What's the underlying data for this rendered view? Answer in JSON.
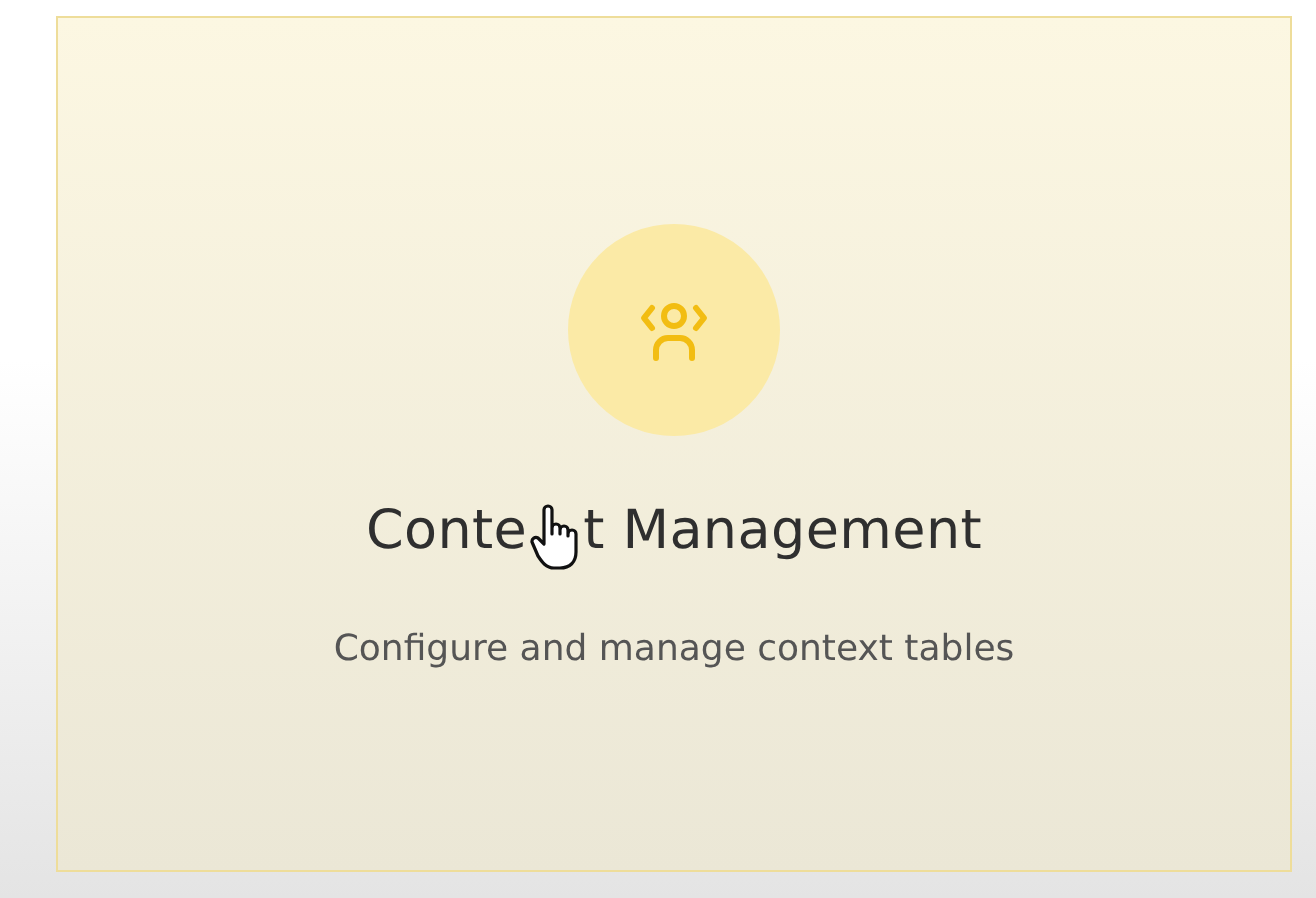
{
  "card": {
    "title_parts": [
      "Conte",
      "t Management"
    ],
    "description": "Configure and manage context tables"
  }
}
